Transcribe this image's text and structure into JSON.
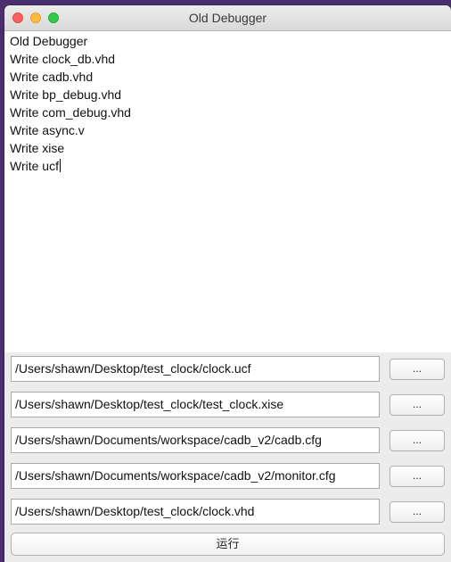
{
  "window": {
    "title": "Old Debugger"
  },
  "log": {
    "lines": [
      "Old Debugger",
      "Write clock_db.vhd",
      "Write cadb.vhd",
      "Write bp_debug.vhd",
      "Write com_debug.vhd",
      "Write async.v",
      "Write xise",
      "Write ucf"
    ]
  },
  "files": [
    {
      "path": "/Users/shawn/Desktop/test_clock/clock.ucf",
      "browse_label": "..."
    },
    {
      "path": "/Users/shawn/Desktop/test_clock/test_clock.xise",
      "browse_label": "..."
    },
    {
      "path": "/Users/shawn/Documents/workspace/cadb_v2/cadb.cfg",
      "browse_label": "..."
    },
    {
      "path": "/Users/shawn/Documents/workspace/cadb_v2/monitor.cfg",
      "browse_label": "..."
    },
    {
      "path": "/Users/shawn/Desktop/test_clock/clock.vhd",
      "browse_label": "..."
    }
  ],
  "run_button": {
    "label": "运行"
  }
}
